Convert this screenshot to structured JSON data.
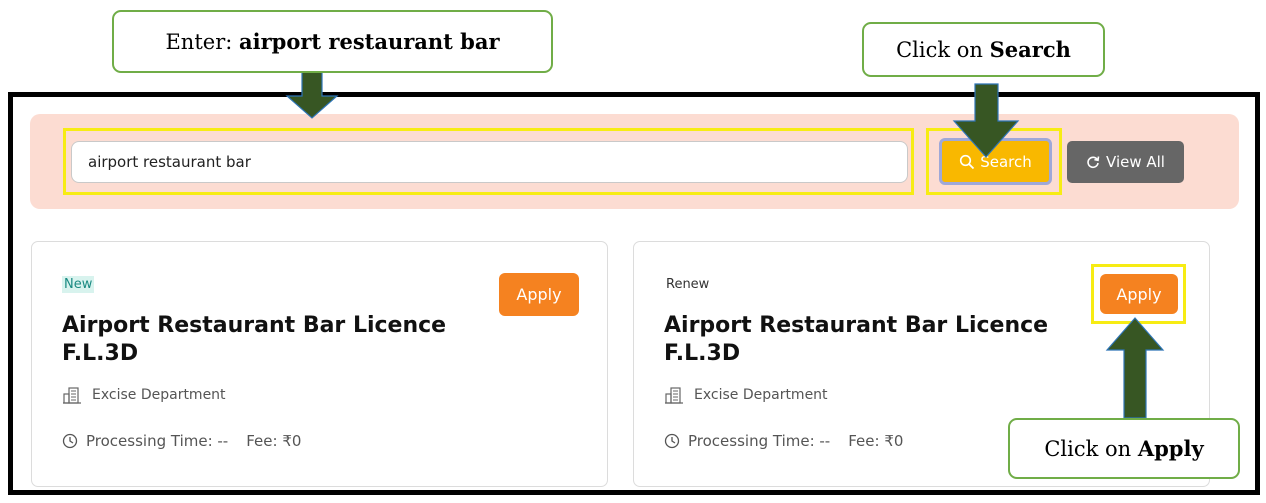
{
  "search": {
    "value": "airport restaurant bar",
    "search_label": "Search",
    "viewall_label": "View All"
  },
  "cards": [
    {
      "type": "New",
      "apply_label": "Apply",
      "title": "Airport Restaurant Bar Licence F.L.3D",
      "department": "Excise Department",
      "processing": "Processing Time: --",
      "fee": "Fee: ₹0"
    },
    {
      "type": "Renew",
      "apply_label": "Apply",
      "title": "Airport Restaurant Bar Licence F.L.3D",
      "department": "Excise Department",
      "processing": "Processing Time: --",
      "fee": "Fee: ₹0"
    }
  ],
  "callouts": {
    "enter_prefix": "Enter: ",
    "enter_bold": "airport restaurant bar",
    "search_prefix": "Click on ",
    "search_bold": "Search",
    "apply_prefix": "Click on ",
    "apply_bold": "Apply"
  },
  "colors": {
    "highlight": "#f7ec13",
    "arrow": "#375623",
    "callout_border": "#70ad47",
    "search_button": "#f9b800",
    "apply_button": "#f58220"
  },
  "icons": [
    "search-icon",
    "refresh-icon",
    "building-icon",
    "clock-icon",
    "arrow-down-icon",
    "arrow-up-icon"
  ]
}
